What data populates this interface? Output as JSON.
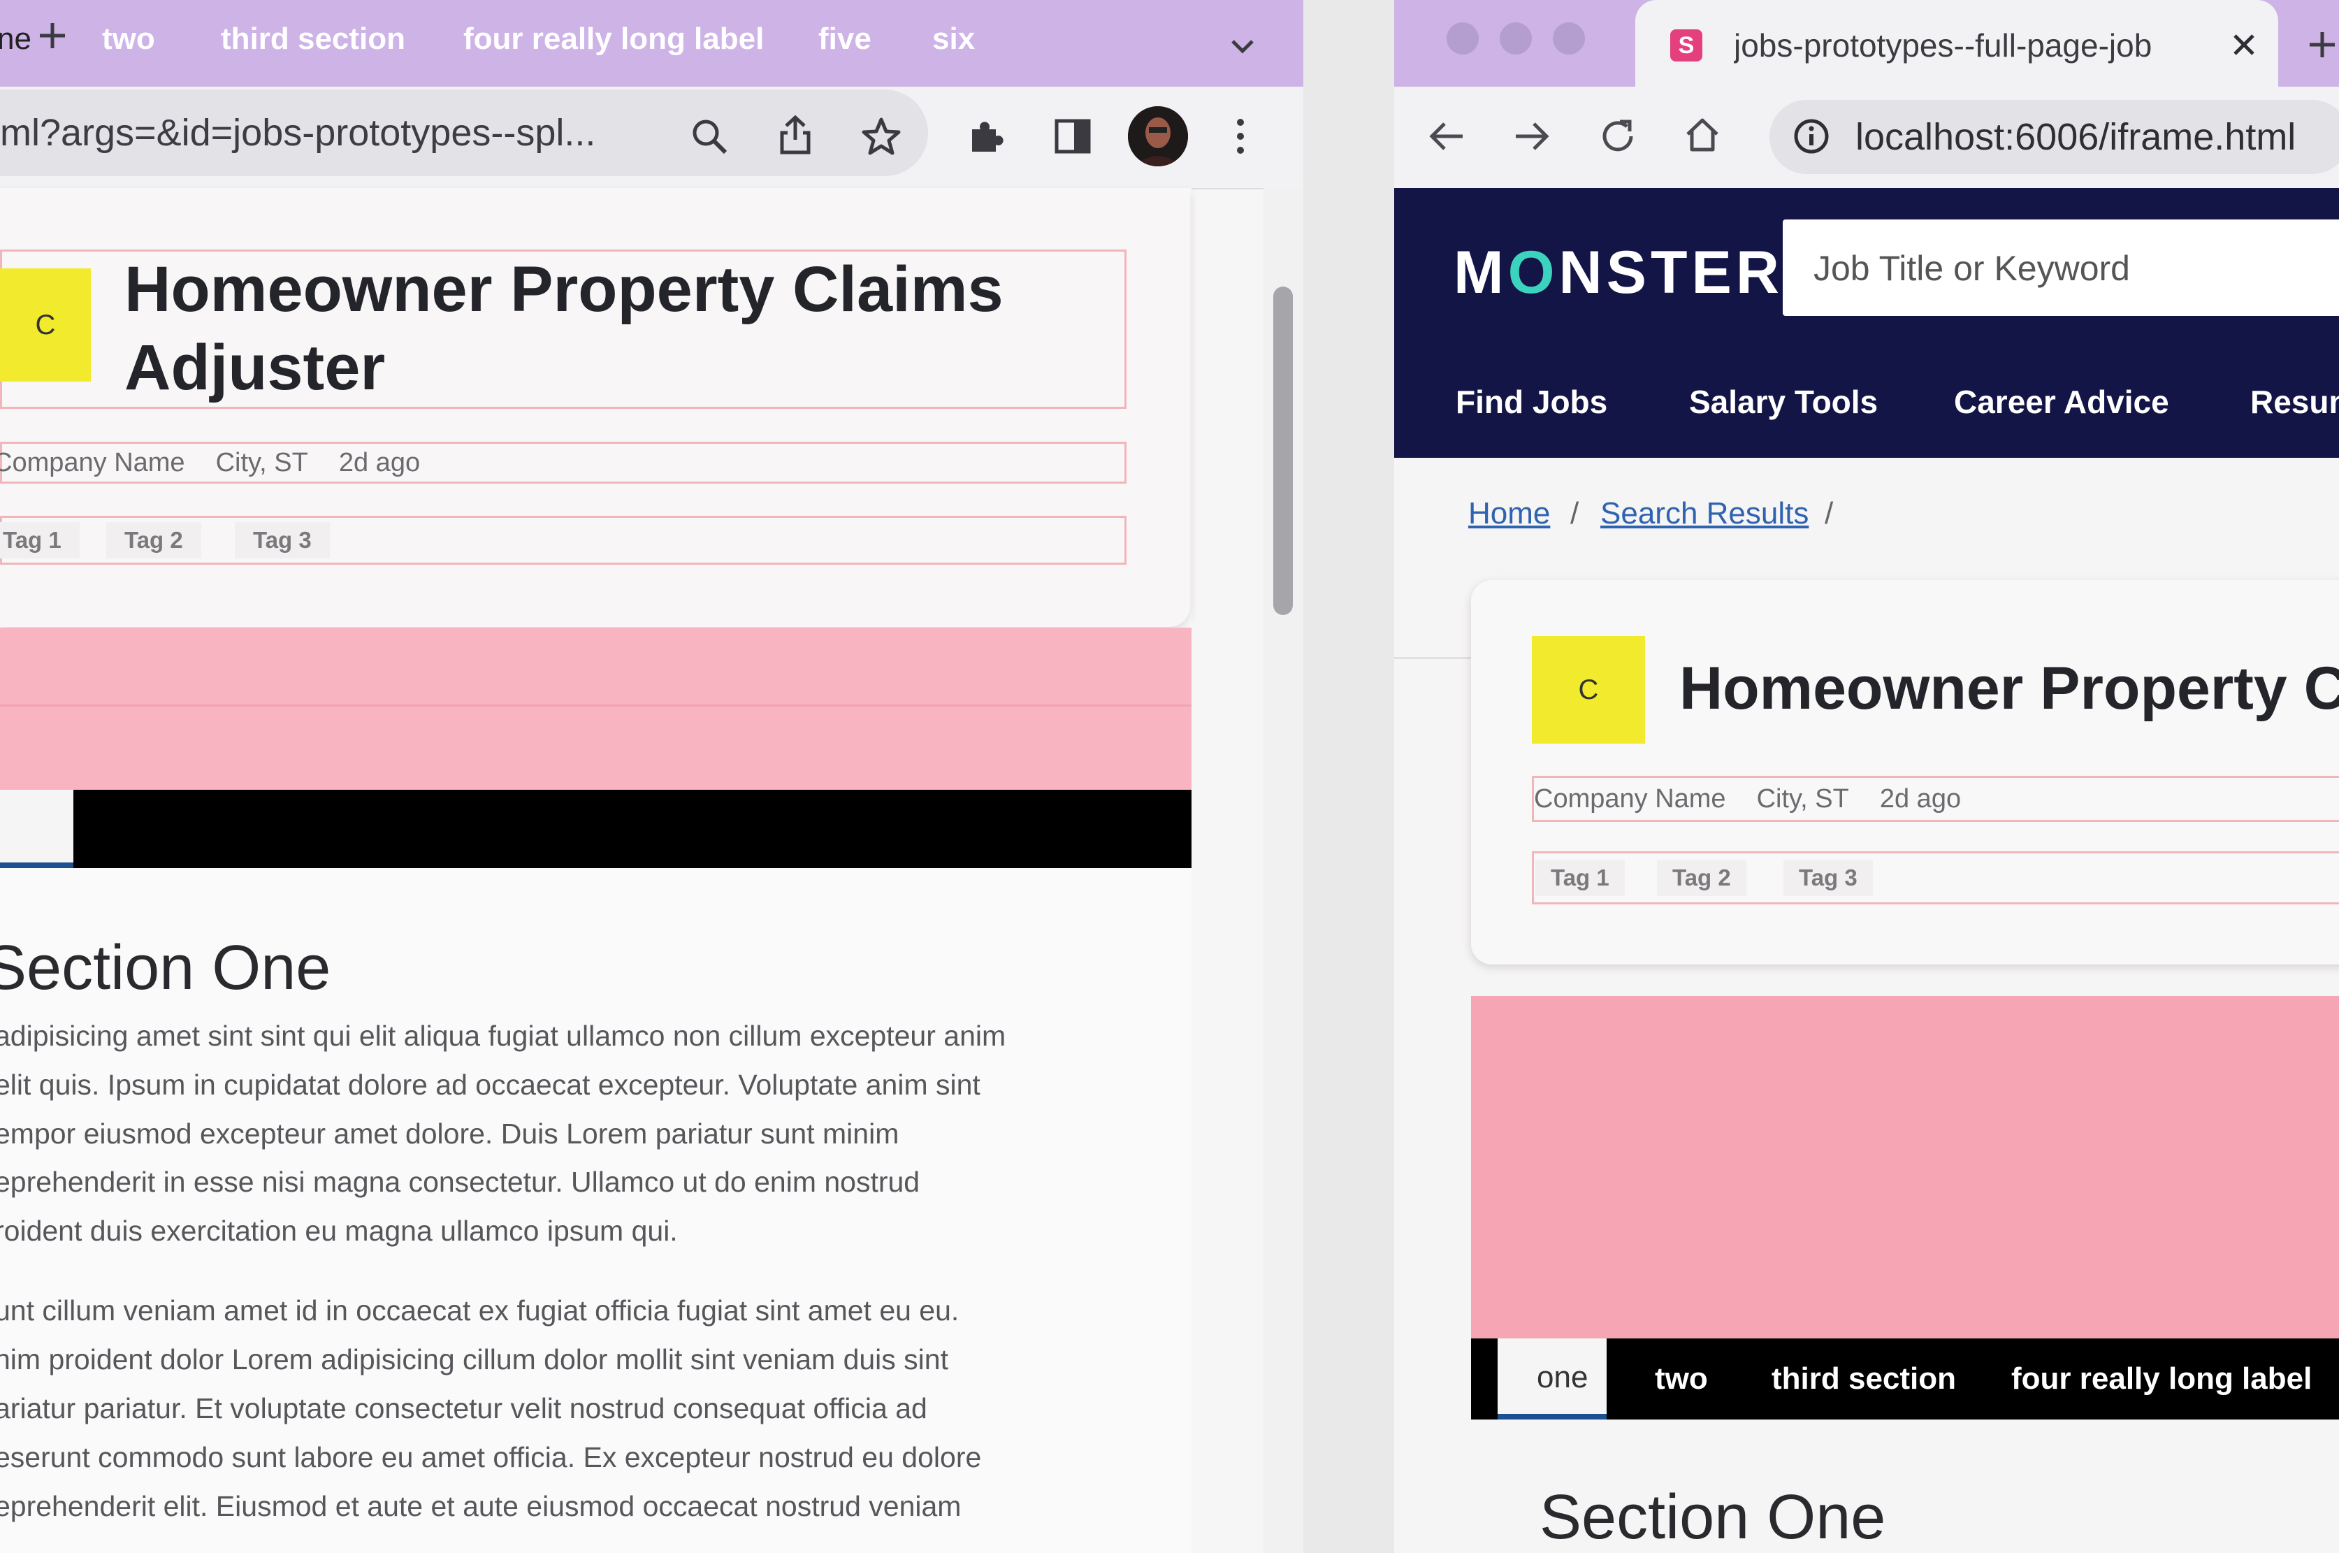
{
  "left_browser": {
    "url": "ml?args=&id=jobs-prototypes--spl...",
    "job_header": {
      "logo_letter": "C",
      "title": "Homeowner Property Claims Adjuster",
      "company": "Company Name",
      "location": "City, ST",
      "posted": "2d ago",
      "tags": [
        "Tag 1",
        "Tag 2",
        "Tag 3"
      ]
    },
    "section_tabs": [
      "ne",
      "two",
      "third section",
      "four really long label",
      "five",
      "six"
    ],
    "section": {
      "title": "Section One",
      "paragraph1": [
        "adipisicing amet sint sint qui elit aliqua fugiat ullamco non cillum excepteur anim",
        "elit quis. Ipsum in cupidatat dolore ad occaecat excepteur. Voluptate anim sint",
        "empor eiusmod excepteur amet dolore. Duis Lorem pariatur sunt minim",
        "eprehenderit in esse nisi magna consectetur. Ullamco ut do enim nostrud",
        "roident duis exercitation eu magna ullamco ipsum qui."
      ],
      "paragraph2": [
        "unt cillum veniam amet id in occaecat ex fugiat officia fugiat sint amet eu eu.",
        "nim proident dolor Lorem adipisicing cillum dolor mollit sint veniam duis sint",
        "ariatur pariatur. Et voluptate consectetur velit nostrud consequat officia ad",
        "eserunt commodo sunt labore eu amet officia. Ex excepteur nostrud eu dolore",
        "eprehenderit elit. Eiusmod et aute et aute eiusmod occaecat nostrud veniam"
      ]
    }
  },
  "right_browser": {
    "tab_title": "jobs-prototypes--full-page-job",
    "favicon_letter": "S",
    "url": "localhost:6006/iframe.html",
    "site": {
      "logo_pre": "M",
      "logo_o": "O",
      "logo_post": "NSTER",
      "search_placeholder": "Job Title or Keyword",
      "nav": [
        "Find Jobs",
        "Salary Tools",
        "Career Advice",
        "Resum"
      ]
    },
    "breadcrumb": {
      "home": "Home",
      "results": "Search Results",
      "separator": "/"
    },
    "job_header": {
      "logo_letter": "C",
      "title": "Homeowner Property C",
      "company": "Company Name",
      "location": "City, ST",
      "posted": "2d ago",
      "tags": [
        "Tag 1",
        "Tag 2",
        "Tag 3"
      ]
    },
    "section_tabs": [
      "one",
      "two",
      "third section",
      "four really long label"
    ],
    "section_title": "Section One"
  },
  "colors": {
    "tab_strip": "#cdb3e6",
    "monster_navy": "#141547",
    "monster_teal": "#3cd3be",
    "hero_pink": "#f8b4c0",
    "logo_yellow": "#f2ea2c",
    "link_blue": "#2f63b0",
    "tag_outline": "#f0b6ba"
  }
}
